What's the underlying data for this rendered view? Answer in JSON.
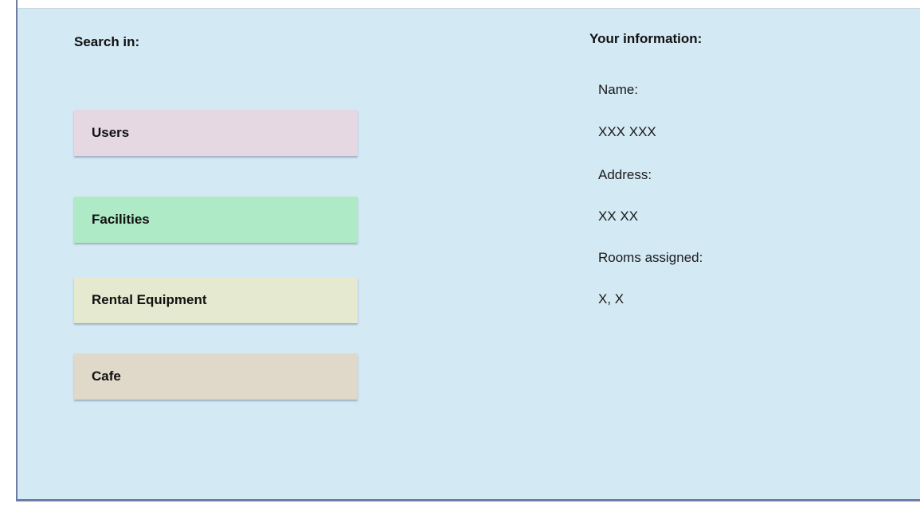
{
  "search": {
    "heading": "Search in:",
    "categories": [
      {
        "label": "Users",
        "color": "#e6d8e2"
      },
      {
        "label": "Facilities",
        "color": "#aeeac5"
      },
      {
        "label": "Rental Equipment",
        "color": "#e5e9cf"
      },
      {
        "label": "Cafe",
        "color": "#e0d8c9"
      }
    ]
  },
  "info": {
    "heading": "Your information:",
    "name_label": "Name:",
    "name_value": "XXX XXX",
    "address_label": "Address:",
    "address_value": "XX XX",
    "rooms_label": "Rooms assigned:",
    "rooms_value": "X, X"
  },
  "colors": {
    "panel_background": "#d3e9f3",
    "panel_border": "#6f7ba3"
  }
}
